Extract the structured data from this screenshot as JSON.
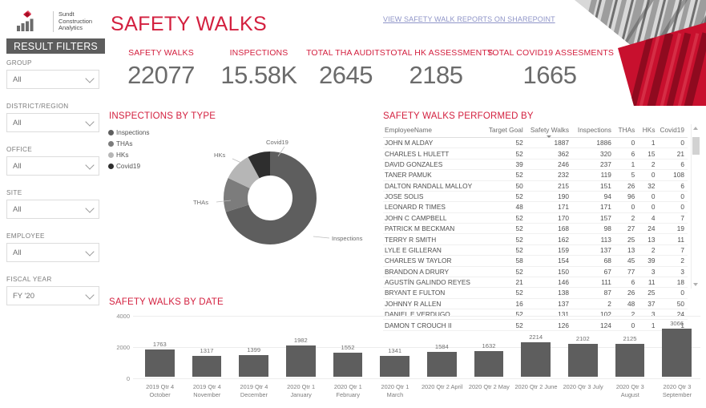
{
  "brand": {
    "logo_line1": "Sundt",
    "logo_line2": "Construction",
    "logo_line3": "Analytics",
    "accent_red": "#d3203f",
    "logo_red": "#c8102e",
    "gray_dark": "#5d5d5d",
    "link_color": "#8f95c8"
  },
  "header": {
    "title": "SAFETY WALKS",
    "sharepoint_link": "VIEW SAFETY WALK REPORTS ON SHAREPOINT"
  },
  "sidebar": {
    "banner": "RESULT FILTERS",
    "filters": [
      {
        "label": "GROUP",
        "value": "All"
      },
      {
        "label": "DISTRICT/REGION",
        "value": "All"
      },
      {
        "label": "OFFICE",
        "value": "All"
      },
      {
        "label": "SITE",
        "value": "All"
      },
      {
        "label": "EMPLOYEE",
        "value": "All"
      },
      {
        "label": "FISCAL YEAR",
        "value": "FY '20"
      }
    ]
  },
  "kpis": [
    {
      "label": "SAFETY WALKS",
      "value": "22077"
    },
    {
      "label": "INSPECTIONS",
      "value": "15.58K"
    },
    {
      "label": "TOTAL THA AUDITS",
      "value": "2645"
    },
    {
      "label": "TOTAL HK ASSESSMENTS",
      "value": "2185"
    },
    {
      "label": "TOTAL COVID19 ASSESMENTS",
      "value": "1665"
    }
  ],
  "donut_panel": {
    "title": "INSPECTIONS BY TYPE"
  },
  "table_panel": {
    "title": "SAFETY WALKS PERFORMED BY"
  },
  "bars_panel": {
    "title": "SAFETY WALKS BY DATE"
  },
  "table": {
    "columns": [
      "EmployeeName",
      "Target Goal",
      "Safety Walks",
      "Inspections",
      "THAs",
      "HKs",
      "Covid19"
    ],
    "sorted_column": "Safety Walks",
    "rows": [
      {
        "name": "JOHN M ALDAY",
        "target": "52",
        "walks": "1887",
        "inspections": "1886",
        "thas": "0",
        "hks": "1",
        "covid": "0"
      },
      {
        "name": "CHARLES L HULETT",
        "target": "52",
        "walks": "362",
        "inspections": "320",
        "thas": "6",
        "hks": "15",
        "covid": "21"
      },
      {
        "name": "DAVID GONZALES",
        "target": "39",
        "walks": "246",
        "inspections": "237",
        "thas": "1",
        "hks": "2",
        "covid": "6"
      },
      {
        "name": "TANER PAMUK",
        "target": "52",
        "walks": "232",
        "inspections": "119",
        "thas": "5",
        "hks": "0",
        "covid": "108"
      },
      {
        "name": "DALTON RANDALL MALLOY",
        "target": "50",
        "walks": "215",
        "inspections": "151",
        "thas": "26",
        "hks": "32",
        "covid": "6"
      },
      {
        "name": "JOSE SOLIS",
        "target": "52",
        "walks": "190",
        "inspections": "94",
        "thas": "96",
        "hks": "0",
        "covid": "0"
      },
      {
        "name": "LEONARD R TIMES",
        "target": "48",
        "walks": "171",
        "inspections": "171",
        "thas": "0",
        "hks": "0",
        "covid": "0"
      },
      {
        "name": "JOHN C CAMPBELL",
        "target": "52",
        "walks": "170",
        "inspections": "157",
        "thas": "2",
        "hks": "4",
        "covid": "7"
      },
      {
        "name": "PATRICK M BECKMAN",
        "target": "52",
        "walks": "168",
        "inspections": "98",
        "thas": "27",
        "hks": "24",
        "covid": "19"
      },
      {
        "name": "TERRY R SMITH",
        "target": "52",
        "walks": "162",
        "inspections": "113",
        "thas": "25",
        "hks": "13",
        "covid": "11"
      },
      {
        "name": "LYLE E GILLERAN",
        "target": "52",
        "walks": "159",
        "inspections": "137",
        "thas": "13",
        "hks": "2",
        "covid": "7"
      },
      {
        "name": "CHARLES W TAYLOR",
        "target": "58",
        "walks": "154",
        "inspections": "68",
        "thas": "45",
        "hks": "39",
        "covid": "2"
      },
      {
        "name": "BRANDON A DRURY",
        "target": "52",
        "walks": "150",
        "inspections": "67",
        "thas": "77",
        "hks": "3",
        "covid": "3"
      },
      {
        "name": "AGUSTÍN GALINDO REYES",
        "target": "21",
        "walks": "146",
        "inspections": "111",
        "thas": "6",
        "hks": "11",
        "covid": "18"
      },
      {
        "name": "BRYANT E FULTON",
        "target": "52",
        "walks": "138",
        "inspections": "87",
        "thas": "26",
        "hks": "25",
        "covid": "0"
      },
      {
        "name": "JOHNNY R ALLEN",
        "target": "16",
        "walks": "137",
        "inspections": "2",
        "thas": "48",
        "hks": "37",
        "covid": "50"
      },
      {
        "name": "DANIEL E VERDUGO",
        "target": "52",
        "walks": "131",
        "inspections": "102",
        "thas": "2",
        "hks": "3",
        "covid": "24"
      },
      {
        "name": "DAMON T CROUCH II",
        "target": "52",
        "walks": "126",
        "inspections": "124",
        "thas": "0",
        "hks": "1",
        "covid": "1"
      }
    ]
  },
  "chart_data": [
    {
      "type": "pie",
      "title": "INSPECTIONS BY TYPE",
      "legend_position": "top-left",
      "categories": [
        "Inspections",
        "THAs",
        "HKs",
        "Covid19"
      ],
      "values": [
        70,
        12,
        10,
        8
      ],
      "colors": [
        "#5e5e5e",
        "#7c7c7c",
        "#b6b6b6",
        "#2e2e2e"
      ],
      "callout_labels": [
        "Inspections",
        "THAs",
        "HKs",
        "Covid19"
      ]
    },
    {
      "type": "bar",
      "title": "SAFETY WALKS BY DATE",
      "xlabel": "",
      "ylabel": "",
      "ylim": [
        0,
        4000
      ],
      "yticks": [
        "0",
        "2000",
        "4000"
      ],
      "grid": true,
      "categories": [
        "2019 Qtr 4 October",
        "2019 Qtr 4 November",
        "2019 Qtr 4 December",
        "2020 Qtr 1 January",
        "2020 Qtr 1 February",
        "2020 Qtr 1 March",
        "2020 Qtr 2 April",
        "2020 Qtr 2 May",
        "2020 Qtr 2 June",
        "2020 Qtr 3 July",
        "2020 Qtr 3 August",
        "2020 Qtr 3 September"
      ],
      "category_lines": [
        [
          "2019 Qtr 4",
          "October"
        ],
        [
          "2019 Qtr 4",
          "November"
        ],
        [
          "2019 Qtr 4",
          "December"
        ],
        [
          "2020 Qtr 1",
          "January"
        ],
        [
          "2020 Qtr 1",
          "February"
        ],
        [
          "2020 Qtr 1",
          "March"
        ],
        [
          "2020 Qtr 2 April",
          ""
        ],
        [
          "2020 Qtr 2 May",
          ""
        ],
        [
          "2020 Qtr 2 June",
          ""
        ],
        [
          "2020 Qtr 3 July",
          ""
        ],
        [
          "2020 Qtr 3",
          "August"
        ],
        [
          "2020 Qtr 3",
          "September"
        ]
      ],
      "values": [
        1763,
        1317,
        1399,
        1982,
        1552,
        1341,
        1584,
        1632,
        2214,
        2102,
        2125,
        3066
      ],
      "bar_color": "#5e5e5e"
    }
  ]
}
